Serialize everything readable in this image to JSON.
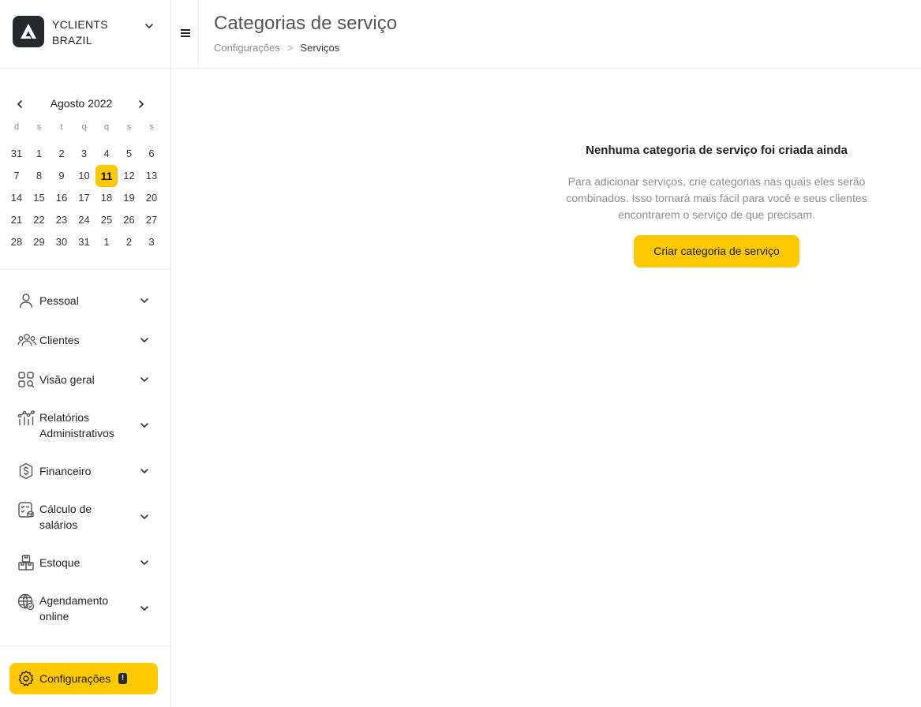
{
  "company": {
    "name_line1": "YCLIENTS",
    "name_line2": "BRAZIL"
  },
  "calendar": {
    "month_label": "Agosto 2022",
    "weekdays": [
      "d",
      "s",
      "t",
      "q",
      "q",
      "s",
      "s"
    ],
    "weeks": [
      [
        "31",
        "1",
        "2",
        "3",
        "4",
        "5",
        "6"
      ],
      [
        "7",
        "8",
        "9",
        "10",
        "11",
        "12",
        "13"
      ],
      [
        "14",
        "15",
        "16",
        "17",
        "18",
        "19",
        "20"
      ],
      [
        "21",
        "22",
        "23",
        "24",
        "25",
        "26",
        "27"
      ],
      [
        "28",
        "29",
        "30",
        "31",
        "1",
        "2",
        "3"
      ]
    ],
    "selected_day": "11"
  },
  "nav": {
    "items": [
      {
        "label": "Pessoal",
        "icon": "user-icon"
      },
      {
        "label": "Clientes",
        "icon": "users-icon"
      },
      {
        "label": "Visão geral",
        "icon": "grid-search-icon"
      },
      {
        "label": "Relatórios Administrativos",
        "icon": "reports-chart-icon"
      },
      {
        "label": "Financeiro",
        "icon": "dollar-badge-icon"
      },
      {
        "label": "Cálculo de salários",
        "icon": "payroll-icon"
      },
      {
        "label": "Estoque",
        "icon": "boxes-icon"
      },
      {
        "label": "Agendamento online",
        "icon": "globe-icon"
      }
    ],
    "settings_label": "Configurações",
    "settings_badge": "!"
  },
  "header": {
    "title": "Categorias de serviço",
    "breadcrumb_parent": "Configurações",
    "breadcrumb_separator": ">",
    "breadcrumb_current": "Serviços"
  },
  "empty_state": {
    "title": "Nenhuma categoria de serviço foi criada ainda",
    "description": "Para adicionar serviços, crie categorias nas quais eles serão combinados. Isso tornará mais fácil para você e seus clientes encontrarem o serviço de que precisam.",
    "button_label": "Criar categoria de serviço"
  },
  "colors": {
    "accent": "#ffc800",
    "dark": "#262a2f"
  }
}
